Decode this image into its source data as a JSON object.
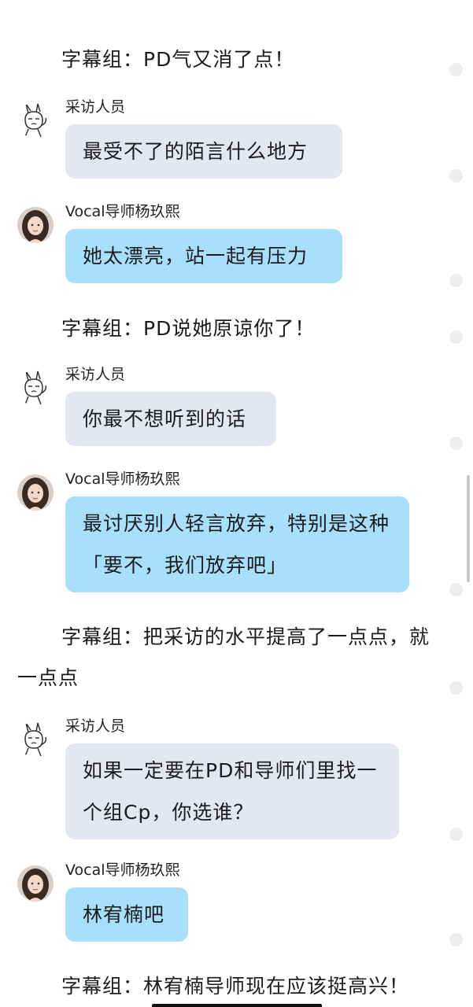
{
  "narrations": [
    {
      "text": "字幕组：PD气又消了点！"
    },
    {
      "text": "字幕组：PD说她原谅你了！"
    },
    {
      "text": "字幕组：把采访的水平提高了一点点，就一点点"
    },
    {
      "text": "字幕组：林宥楠导师现在应该挺高兴！"
    }
  ],
  "messages": [
    {
      "sender": "采访人员",
      "avatar_icon": "rabbit-doodle-icon",
      "text": "最受不了的陌言什么地方"
    },
    {
      "sender": "Vocal导师杨玖熙",
      "avatar_icon": "woman-portrait-avatar",
      "text": "她太漂亮，站一起有压力"
    },
    {
      "sender": "采访人员",
      "avatar_icon": "rabbit-doodle-icon",
      "text": "你最不想听到的话"
    },
    {
      "sender": "Vocal导师杨玖熙",
      "avatar_icon": "woman-portrait-avatar",
      "text": "最讨厌别人轻言放弃，特别是这种「要不，我们放弃吧」"
    },
    {
      "sender": "采访人员",
      "avatar_icon": "rabbit-doodle-icon",
      "text": "如果一定要在PD和导师们里找一个组Cp，你选谁？"
    },
    {
      "sender": "Vocal导师杨玖熙",
      "avatar_icon": "woman-portrait-avatar",
      "text": "林宥楠吧"
    }
  ],
  "colors": {
    "interviewer_bubble": "#e4e7ef",
    "mentor_bubble": "#a8e0fb",
    "background": "#ffffff"
  }
}
